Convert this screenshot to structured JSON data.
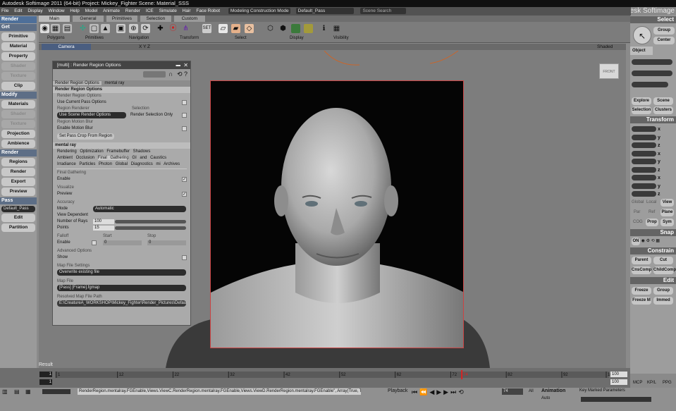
{
  "app": {
    "title": "Autodesk Softimage 2011 (64-bit)    Project: Mickey_Fighter    Scene: Material_SSS",
    "brand": "Autodesk Softimage"
  },
  "menu": {
    "items": [
      "File",
      "Edit",
      "Display",
      "Window",
      "Help",
      "Model",
      "Animate",
      "Render",
      "ICE",
      "Simulate",
      "Hair",
      "Face Robot"
    ],
    "layout": "Modeling Construction Mode",
    "pass": "Default_Pass",
    "search_placeholder": "Scene Search"
  },
  "toprow": {
    "render_label": "Render",
    "tabs": [
      "Main",
      "General",
      "Primitives",
      "Selection",
      "Custom"
    ]
  },
  "toolbar": {
    "groups": [
      "Polygons",
      "Primitives",
      "Navigation",
      "Transform",
      "Select",
      "Display",
      "Visibility"
    ],
    "set_label": "SET"
  },
  "left_panel": {
    "sections": [
      {
        "label": "Get",
        "buttons": [
          "Primitive",
          "Material",
          "Property",
          "Shader",
          "Texture",
          "Clip"
        ]
      },
      {
        "label": "Modify",
        "buttons": [
          "Materials",
          "Shader",
          "Texture",
          "Projection",
          "Ambience"
        ]
      },
      {
        "label": "Render",
        "buttons": [
          "Regions",
          "Render",
          "Export",
          "Preview"
        ]
      },
      {
        "label": "Pass",
        "buttons": [
          "Edit",
          "Partition"
        ]
      }
    ],
    "pass_value": "Default_Pass",
    "dim": [
      "Shader",
      "Texture"
    ]
  },
  "viewport": {
    "camera": "Camera",
    "axes": "X Y Z",
    "shaded": "Shaded",
    "cube": "FRONT",
    "result": "Result"
  },
  "dialog": {
    "title": "[multi] : Render Region Options",
    "tabs": [
      "Render Region Options",
      "mental ray"
    ],
    "rro_header": "Render Region Options",
    "rro_group": "Render Region Options",
    "use_current_pass": "Use Current Pass Options",
    "region_renderer": "Region Renderer",
    "renderer_value": "Use Scene Render Options",
    "selection": "Selection",
    "render_selection_only": "Render Selection Only",
    "motion_blur": "Region Motion Blur",
    "enable_mb": "Enable Motion Blur",
    "crop": "Set Pass Crop From Region",
    "mr_header": "mental ray",
    "mr_tabs": [
      [
        "Rendering",
        "Optimization",
        "Framebuffer",
        "Shadows"
      ],
      [
        "Ambient Occlusion",
        "Final Gathering",
        "GI and Caustics"
      ],
      [
        "Irradiance Particles",
        "Photon Global",
        "Diagnostics",
        "mi Archives"
      ]
    ],
    "fg": "Final Gathering",
    "enable": "Enable",
    "visualize": "Visualize",
    "preview": "Preview",
    "accuracy": "Accuracy",
    "mode": "Mode",
    "mode_value": "Automatic",
    "view_dependent": "View Dependent",
    "rays": "Number of Rays",
    "rays_value": "100",
    "points": "Points",
    "points_value": "15",
    "falloff": "Falloff",
    "start": "Start",
    "stop": "Stop",
    "falloff_enable": "Enable",
    "start_value": "0",
    "stop_value": "0",
    "advanced": "Advanced Options",
    "show": "Show",
    "map_settings": "Map File Settings",
    "map_mode": "Overwrite existing file",
    "map_file": "Map File",
    "map_file_value": "[Pass] [Frame].fgmap",
    "resolved": "Resolved Map File Path",
    "resolved_value": "E:\\CreatureA_WORKSHOP\\Mickey_Fighter\\Render_Pictures\\Default"
  },
  "right_panel": {
    "select": "Select",
    "group": "Group",
    "center": "Center",
    "object": "Object",
    "explore": "Explore",
    "scene": "Scene",
    "selection": "Selection",
    "clusters": "Clusters",
    "transform": "Transform",
    "axes": [
      "x",
      "y",
      "z",
      "x",
      "y",
      "z",
      "x",
      "y",
      "z"
    ],
    "modes": [
      "Global",
      "Local",
      "View",
      "Par",
      "Ref",
      "Plane",
      "COG",
      "Prop",
      "Sym"
    ],
    "snap": "Snap",
    "on": "ON",
    "constrain": "Constrain",
    "parent": "Parent",
    "cut": "Cut",
    "cnscomp": "CnsComp",
    "childcomp": "ChildComp",
    "edit": "Edit",
    "freeze": "Freeze",
    "egroup": "Group",
    "freezem": "Freeze M",
    "immed": "Immed"
  },
  "timeline": {
    "ticks": [
      "1",
      "12",
      "22",
      "32",
      "42",
      "52",
      "62",
      "72",
      "82",
      "92",
      "100"
    ],
    "start": "1",
    "end": "100",
    "current": "74",
    "left_num": "1",
    "right_num": "100"
  },
  "bottom": {
    "cmdline": "RenderRegion.mentalray.FGEnable,Views.ViewC.RenderRegion.mentalray.FGEnable,Views.ViewD.RenderRegion.mentalray.FGEnable\", Array(True, True, True, True)",
    "playback": "Playback",
    "frame": "74",
    "all": "All",
    "animation": "Animation",
    "auto": "Auto",
    "key_params": "Key Marked Parameters",
    "mcp": "MCP",
    "kpl": "KP/L",
    "ppg": "PPG"
  }
}
